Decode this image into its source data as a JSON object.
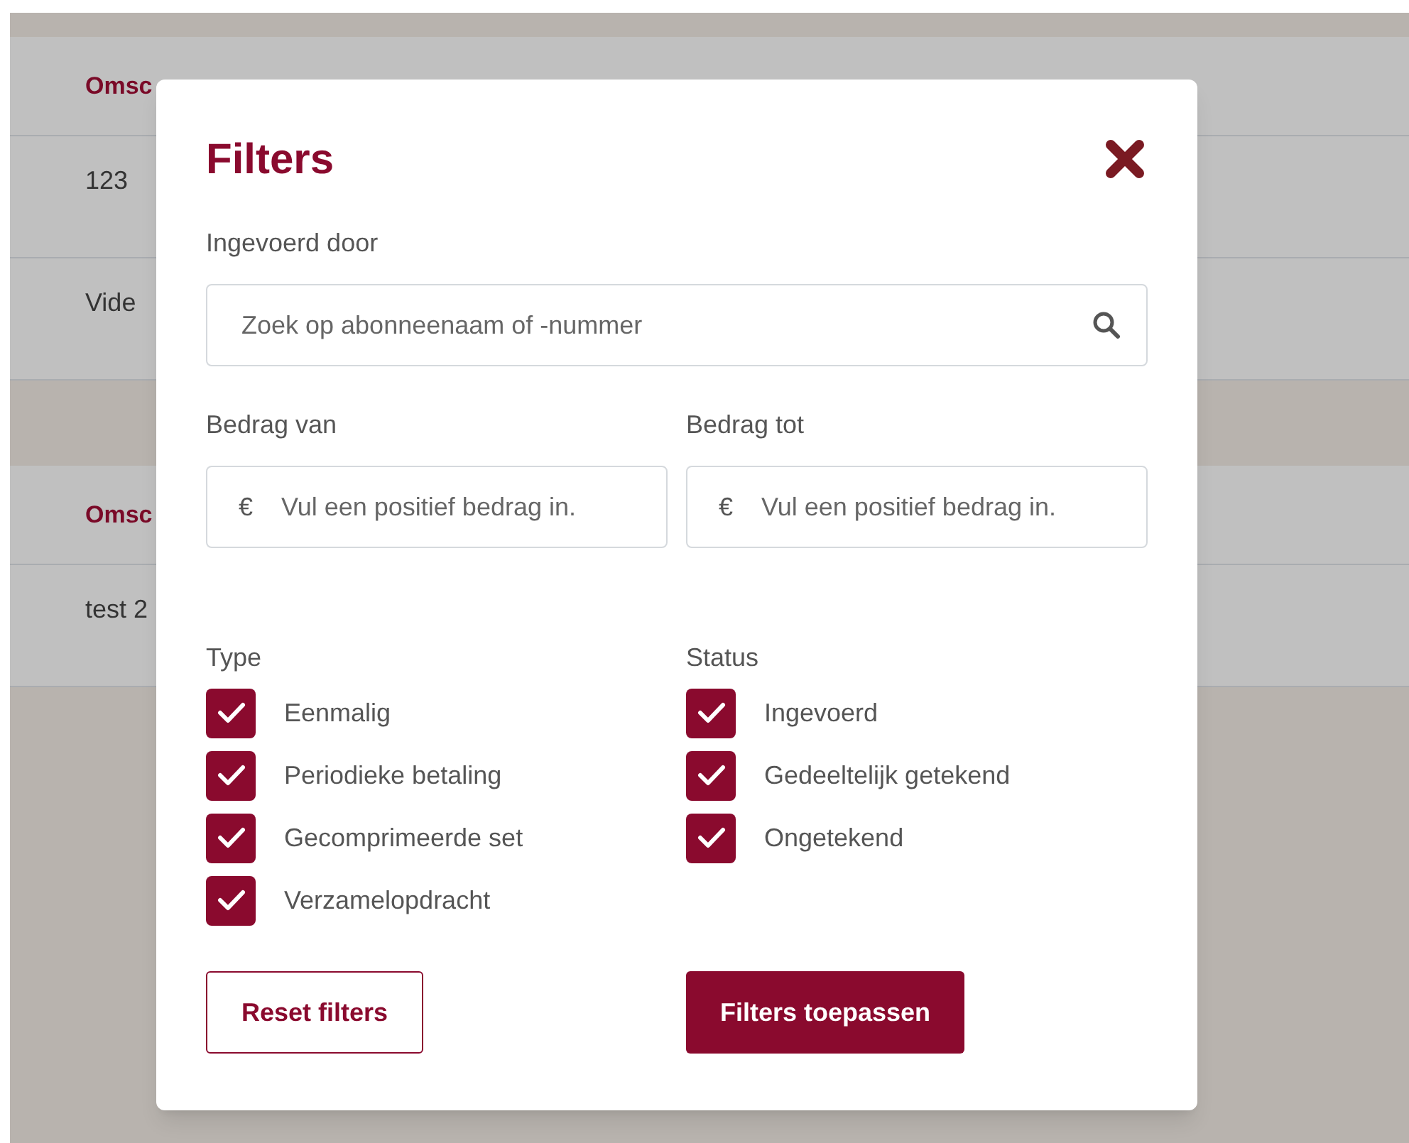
{
  "background": {
    "cards": [
      {
        "header": "Omsc",
        "rows": [
          "123",
          "Vide"
        ]
      },
      {
        "header": "Omsc",
        "rows": [
          "test 2"
        ]
      }
    ]
  },
  "dialog": {
    "title": "Filters",
    "entered_by": {
      "label": "Ingevoerd door",
      "placeholder": "Zoek op abonneenaam of -nummer"
    },
    "amount_from": {
      "label": "Bedrag van",
      "prefix": "€",
      "placeholder": "Vul een positief bedrag in."
    },
    "amount_to": {
      "label": "Bedrag tot",
      "prefix": "€",
      "placeholder": "Vul een positief bedrag in."
    },
    "type": {
      "label": "Type",
      "options": [
        {
          "label": "Eenmalig",
          "checked": true
        },
        {
          "label": "Periodieke betaling",
          "checked": true
        },
        {
          "label": "Gecomprimeerde set",
          "checked": true
        },
        {
          "label": "Verzamelopdracht",
          "checked": true
        }
      ]
    },
    "status": {
      "label": "Status",
      "options": [
        {
          "label": "Ingevoerd",
          "checked": true
        },
        {
          "label": "Gedeeltelijk getekend",
          "checked": true
        },
        {
          "label": "Ongetekend",
          "checked": true
        }
      ]
    },
    "reset_button": "Reset filters",
    "apply_button": "Filters toepassen"
  }
}
